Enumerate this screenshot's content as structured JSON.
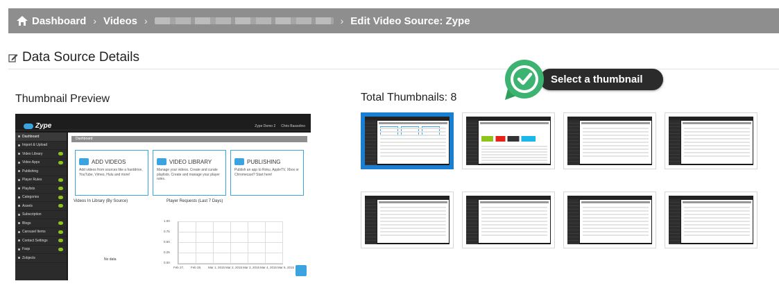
{
  "breadcrumb": {
    "items": [
      "Dashboard",
      "Videos",
      "Edit Video Source: Zype"
    ]
  },
  "section": {
    "title": "Data Source Details"
  },
  "preview": {
    "heading": "Thumbnail Preview",
    "app": {
      "logo": "Zype",
      "account": "Zype Demo 2",
      "user": "Chris Bassolino",
      "breadcrumb": "Dashboard",
      "sidebar": [
        "Dashboard",
        "Import & Upload",
        "Video Library",
        "Video Apps",
        "Publishing",
        "Player Rules",
        "Playlists",
        "Categories",
        "Assets",
        "Subscription",
        "Blogs",
        "Carousel Items",
        "Contact Settings",
        "Faqs",
        "Zobjects"
      ],
      "cards": [
        {
          "title": "ADD VIDEOS",
          "desc": "Add videos from sources like a harddrive, YouTube, Vimeo, Hulu and more!"
        },
        {
          "title": "VIDEO LIBRARY",
          "desc": "Manage your videos. Create and curate playlists. Create and manage your player rules."
        },
        {
          "title": "PUBLISHING",
          "desc": "Publish an app to Roku, AppleTV, Xbox or Chromecast? Start here!"
        }
      ],
      "videos_heading": "Videos In Library (By Source)",
      "requests_heading": "Player Requests (Last 7 Days)",
      "no_data": "No data",
      "y_ticks": [
        "1.00",
        "0.75",
        "0.50",
        "0.25",
        "0.00"
      ],
      "x_ticks": [
        "Feb 27,",
        "Feb 28,",
        "Mar 1, 2015",
        "Mar 2, 2015",
        "Mar 3, 2015",
        "Mar 4, 2015",
        "Mar 5, 2015"
      ]
    }
  },
  "thumbnails": {
    "heading": "Total Thumbnails: 8",
    "count": 8,
    "selected_index": 0
  },
  "callout": {
    "text": "Select a thumbnail",
    "accent": "#3cb371"
  },
  "colors": {
    "bar": "#8e8e8e",
    "selection": "#1a7fd0",
    "brand": "#3ba4e0"
  }
}
